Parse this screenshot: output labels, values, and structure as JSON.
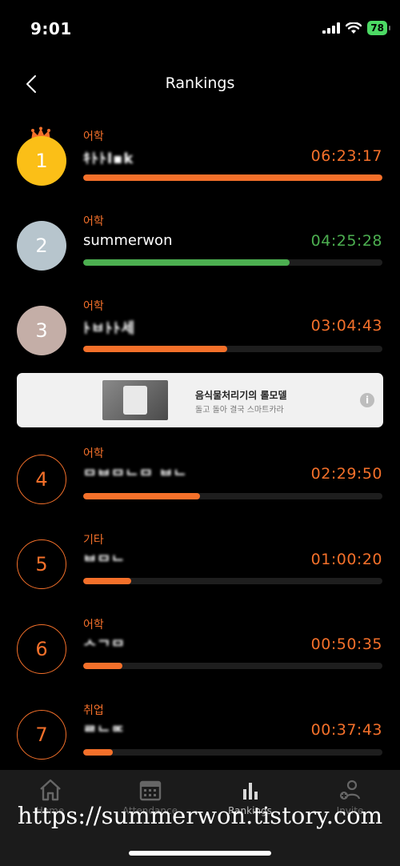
{
  "status": {
    "time": "9:01",
    "battery": "78"
  },
  "nav": {
    "title": "Rankings"
  },
  "rankings": [
    {
      "rank": "1",
      "category": "어학",
      "name": "ｷﾄﾄl▪k",
      "time": "06:23:17",
      "progress": 1.0
    },
    {
      "rank": "2",
      "category": "",
      "name": "summerwon",
      "time": "04:25:28",
      "progress": 0.69
    },
    {
      "rank": "3",
      "category": "어학",
      "name": "ﾄㅂﾄﾄ세",
      "time": "03:04:43",
      "progress": 0.48
    },
    {
      "rank": "4",
      "category": "어학",
      "name": "ᄆᄇᄆᄂᄆ ᄇᄂ",
      "time": "02:29:50",
      "progress": 0.39
    },
    {
      "rank": "5",
      "category": "기타",
      "name": "ᄇᄆᄂ",
      "time": "01:00:20",
      "progress": 0.16
    },
    {
      "rank": "6",
      "category": "어학",
      "name": "ᄉᄀᄆ",
      "time": "00:50:35",
      "progress": 0.13
    },
    {
      "rank": "7",
      "category": "취업",
      "name": "ᄅᄂᄆᄃ",
      "time": "00:37:43",
      "progress": 0.1
    }
  ],
  "ad": {
    "title": "음식물처리기의 롤모델",
    "subtitle": "돌고 돌아 결국 스마트카라",
    "info": "i"
  },
  "tabs": [
    {
      "label": "Home",
      "icon": "home-icon"
    },
    {
      "label": "Attendance",
      "icon": "calendar-icon"
    },
    {
      "label": "Rankings",
      "icon": "bar-chart-icon"
    },
    {
      "label": "Invite",
      "icon": "add-person-icon"
    }
  ],
  "watermark": "https://summerwon.tistory.com",
  "colors": {
    "accent": "#f4702a",
    "green": "#4caf50",
    "gold": "#fbbf17",
    "silver": "#b7c5cd",
    "bronze": "#c4aea7"
  }
}
